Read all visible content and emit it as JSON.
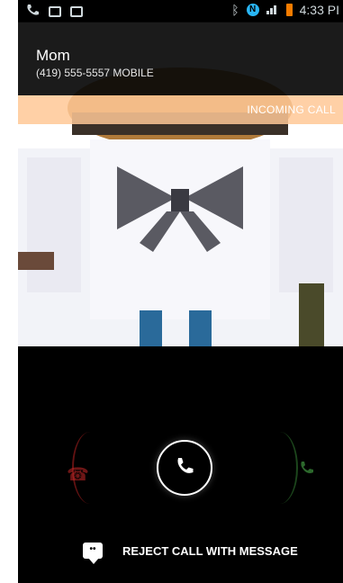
{
  "status_bar": {
    "time": "4:33 PI",
    "left_icons": [
      "phone-icon",
      "mail-icon",
      "image-icon"
    ],
    "right_icons": [
      "bluetooth-icon",
      "nfc-icon",
      "signal-icon",
      "battery-icon"
    ],
    "nfc_label": "N",
    "battery_color": "#f57c00"
  },
  "caller": {
    "name": "Mom",
    "number": "(419) 555-5557",
    "number_type": "MOBILE"
  },
  "incoming_label": "INCOMING CALL",
  "actions": {
    "reject_with_message": "REJECT CALL WITH MESSAGE"
  },
  "colors": {
    "accent_incoming": "#ffc896",
    "answer_ring": "#ffffff",
    "reject": "#c82828",
    "accept": "#50be50"
  }
}
